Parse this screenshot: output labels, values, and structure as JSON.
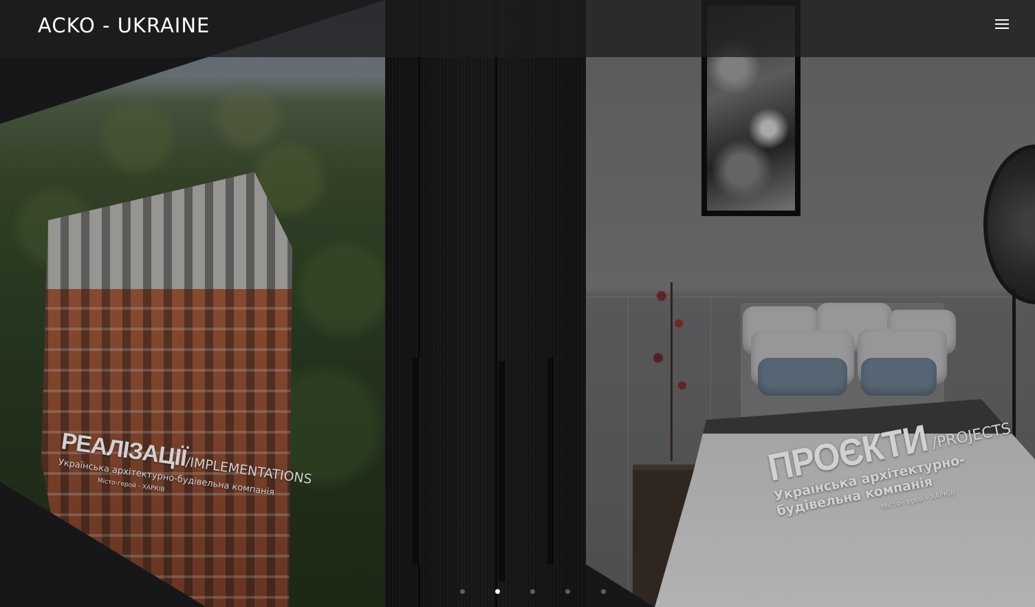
{
  "header": {
    "brand": "ACKO - UKRAINE",
    "menu_icon": "hamburger-menu-icon"
  },
  "slides": {
    "left": {
      "title": "РЕАЛІЗАЦІЇ",
      "title_en": "/IMPLEMENTATIONS",
      "subtitle": "Українська архітектурно-будівельна компанія",
      "city": "Місто-герой - ХАРКІВ"
    },
    "right": {
      "title": "ПРОЄКТИ",
      "title_en": "/PROJECTS",
      "subtitle": "Українська архітектурно-будівельна компанія",
      "city": "Місто-герой - ХАРКІВ"
    }
  },
  "slider": {
    "dot_count": 5,
    "active_index": 1
  },
  "colors": {
    "header_bg": "#1e1e20",
    "text": "#ffffff",
    "dot_inactive": "#5e5e60",
    "dot_active": "#ffffff"
  }
}
